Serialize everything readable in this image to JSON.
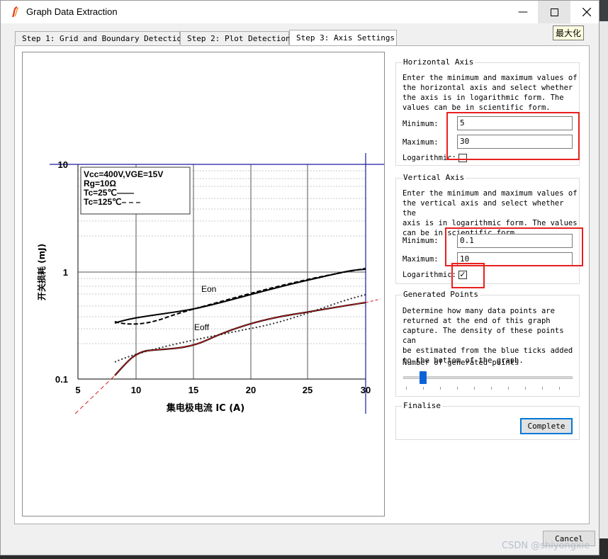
{
  "window": {
    "title": "Graph Data Extraction",
    "tooltip": "最大化"
  },
  "tabs": [
    {
      "label": "Step 1: Grid and Boundary Detection"
    },
    {
      "label": "Step 2: Plot Detection"
    },
    {
      "label": "Step 3: Axis Settings"
    }
  ],
  "graph": {
    "legend": [
      "Vcc=400V,VGE=15V",
      "Rg=10Ω",
      "Tc=25℃——",
      "Tc=125℃– – –"
    ],
    "ylabel": "开关损耗 (mJ)",
    "xlabel": "集电极电流 IC (A)",
    "x_ticks": [
      "5",
      "10",
      "15",
      "20",
      "25",
      "30"
    ],
    "y_ticks": [
      "10",
      "1",
      "0.1"
    ],
    "eon_label": "Eon",
    "eoff_label": "Eoff"
  },
  "horizontal_axis": {
    "title": "Horizontal Axis",
    "desc": [
      "Enter the minimum and maximum values of",
      "the horizontal axis and select whether",
      "the axis is in logarithmic form. The",
      "values can be in scientific form."
    ],
    "min_label": "Minimum:",
    "min_value": "5",
    "max_label": "Maximum:",
    "max_value": "30",
    "log_label": "Logarithmic:",
    "log_checked": false
  },
  "vertical_axis": {
    "title": "Vertical Axis",
    "desc": [
      "Enter the minimum and maximum values of",
      "the vertical axis and select whether the",
      "axis is in logarithmic form. The values",
      "can be in scientific form."
    ],
    "min_label": "Minimum:",
    "min_value": "0.1",
    "max_label": "Maximum:",
    "max_value": "10",
    "log_label": "Logarithmic:",
    "log_checked": true,
    "check_glyph": "✓"
  },
  "generated_points": {
    "title": "Generated Points",
    "desc": [
      "Determine how many data points are",
      "returned at the end of this graph",
      "capture. The density of these points can",
      "be estimated from the blue ticks added",
      "to the bottom of the graph."
    ],
    "slider_label": "Number of generated points"
  },
  "finalise": {
    "title": "Finalise",
    "complete_label": "Complete"
  },
  "footer": {
    "cancel_label": "Cancel"
  },
  "watermark": "CSDN @shiyongxie",
  "colors": {
    "highlight": "#e8201e",
    "slider": "#0a64d6",
    "accent": "#0078d7"
  }
}
